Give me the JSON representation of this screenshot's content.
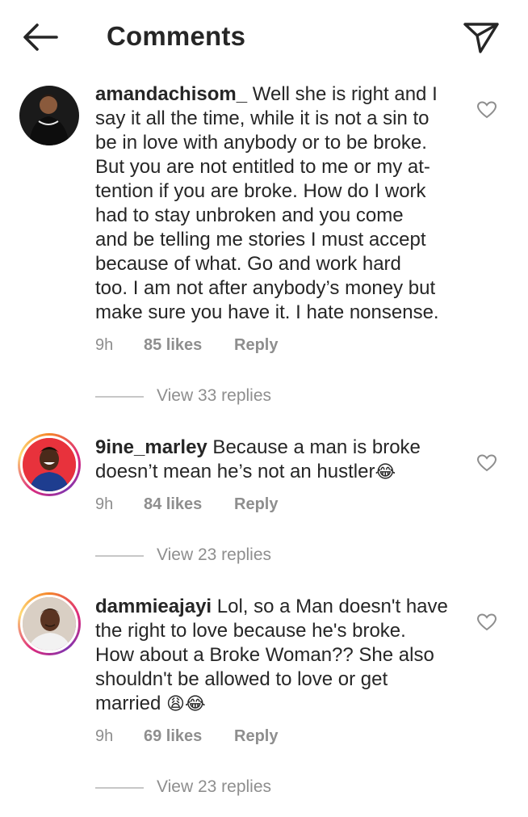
{
  "header": {
    "title": "Comments",
    "back_icon": "arrow-left-icon",
    "send_icon": "paper-plane-icon"
  },
  "comments": [
    {
      "username": "amandachisom_",
      "text": [
        " Well she is right and I",
        "say it all the time, while it is not a sin to",
        "be in love with anybody or to be broke.",
        "But you are not entitled to me or my at-",
        "tention if you are broke. How do I work",
        "had to stay unbroken and you come",
        "and be telling me stories I must accept",
        "because of what. Go and work hard",
        "too. I am not after anybody’s money but",
        "make sure you have it. I hate nonsense."
      ],
      "time": "9h",
      "likes": "85 likes",
      "reply_label": "Reply",
      "view_replies": "View 33 replies"
    },
    {
      "username": "9ine_marley",
      "text": [
        " Because a man is broke",
        "doesn’t mean he’s not an hustler"
      ],
      "emoji": "😂",
      "time": "9h",
      "likes": "84 likes",
      "reply_label": "Reply",
      "view_replies": "View 23 replies"
    },
    {
      "username": "dammieajayi",
      "text": [
        " Lol, so a Man doesn't have",
        "the right to love because he's broke.",
        "How about a Broke Woman?? She also",
        "shouldn't be allowed to love or get",
        "married "
      ],
      "emoji": "😩😂",
      "time": "9h",
      "likes": "69 likes",
      "reply_label": "Reply",
      "view_replies": "View 23 replies"
    }
  ],
  "colors": {
    "text": "#262626",
    "secondary": "#8e8e8e",
    "story_ring_start": "#f58529",
    "story_ring_end": "#dd2a7b"
  }
}
